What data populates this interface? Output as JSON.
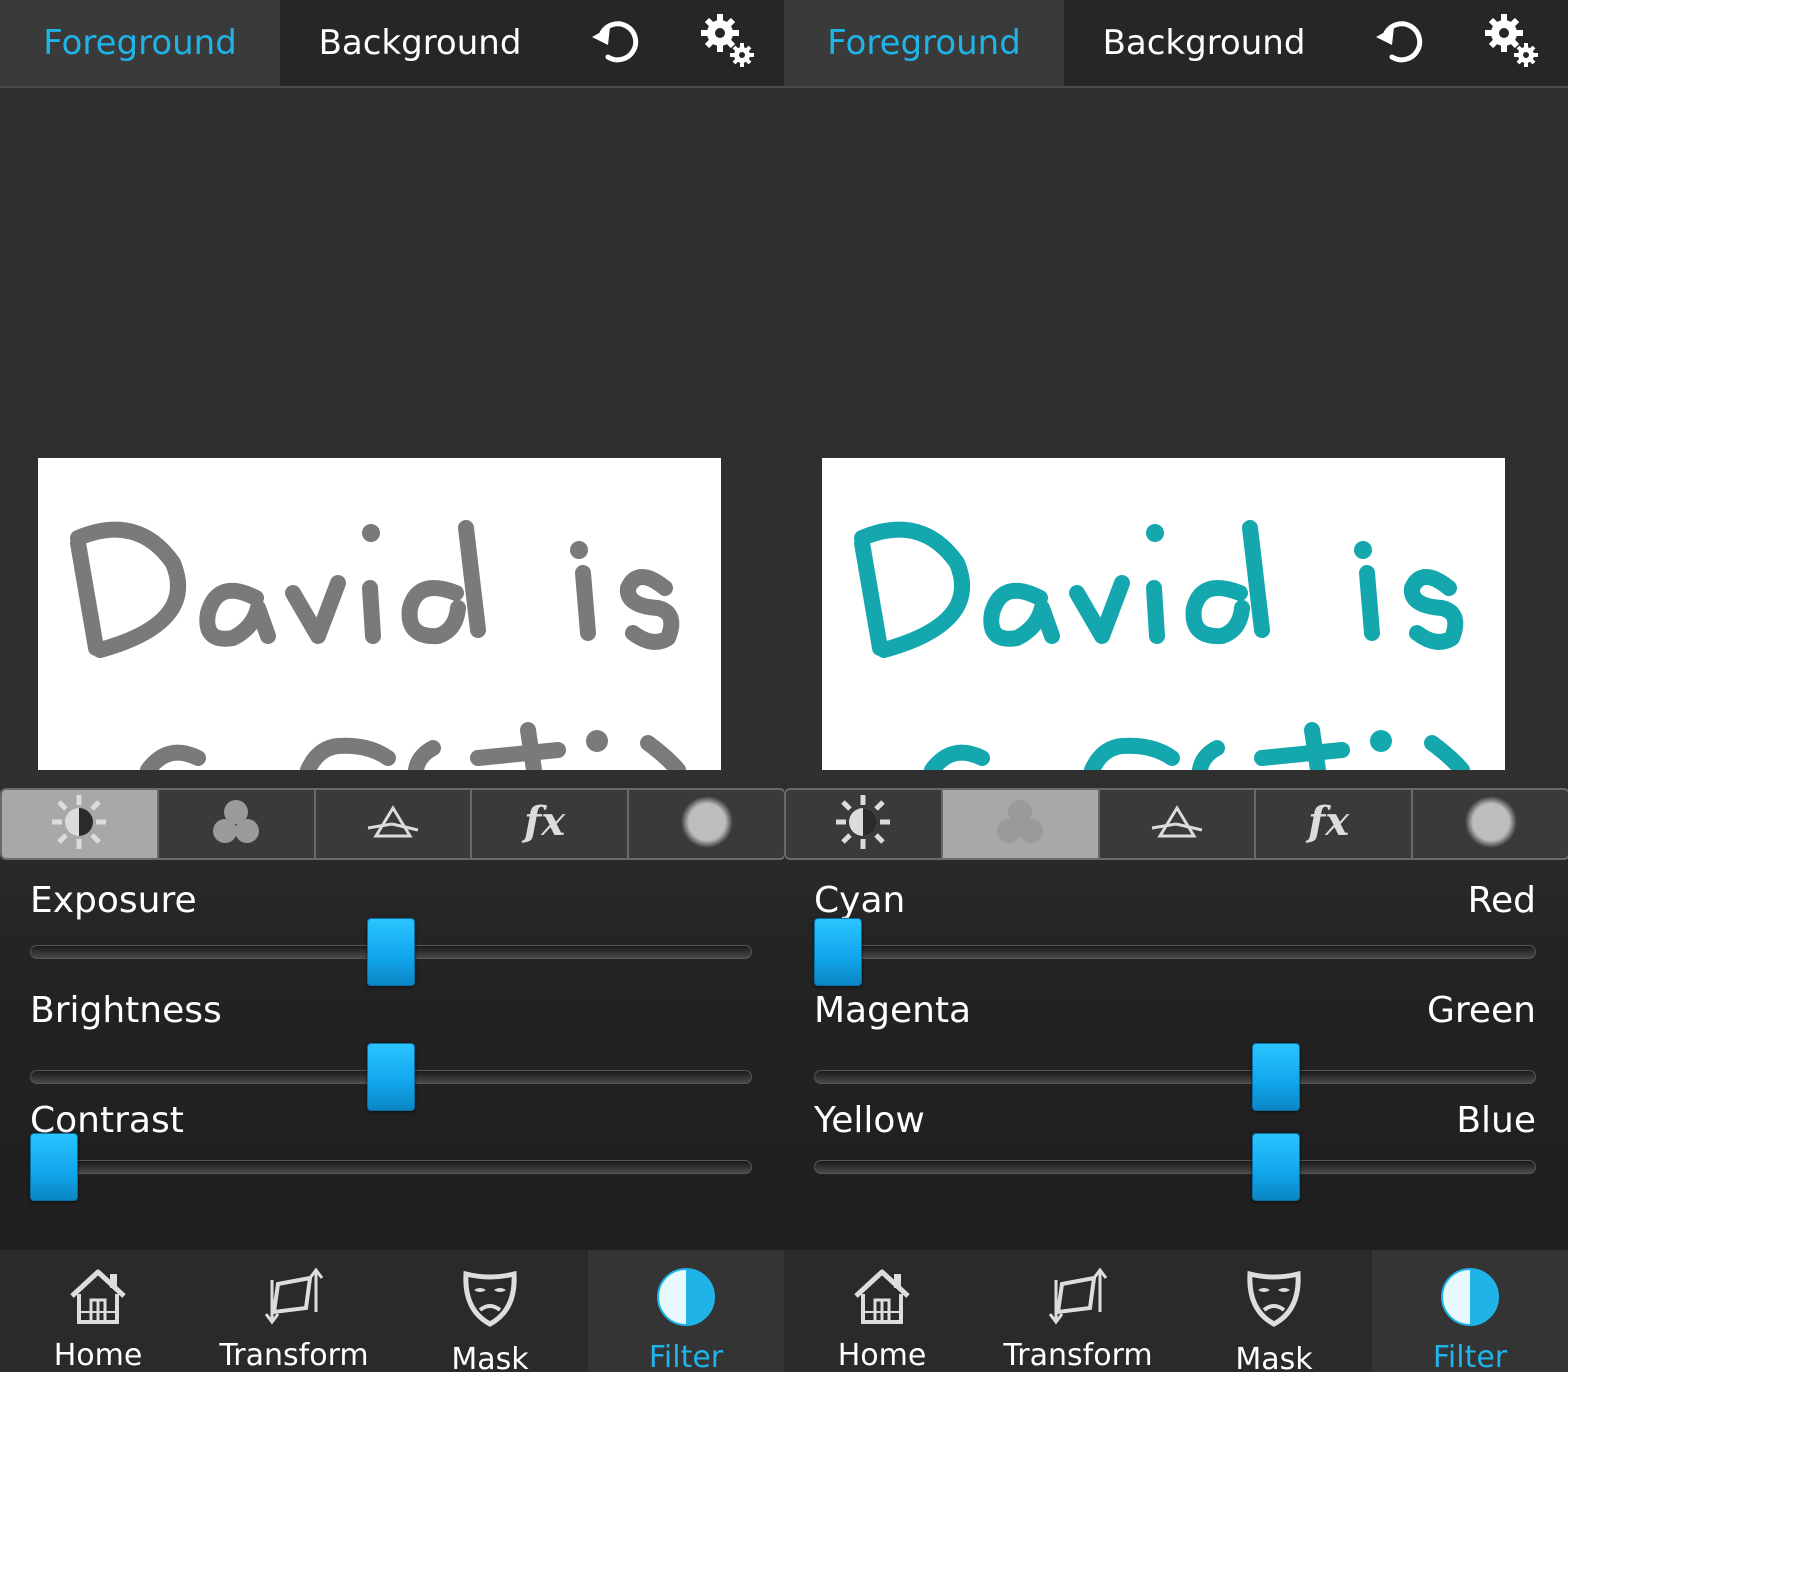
{
  "screens": [
    {
      "top_tabs": {
        "foreground": "Foreground",
        "background": "Background"
      },
      "top_icons": [
        "undo-icon",
        "settings-icon"
      ],
      "photo_text": "David is a rat :)",
      "photo_ink_color": "#7a7a7a",
      "category_tabs": [
        "light-icon",
        "color-icon",
        "prism-icon",
        "fx-icon",
        "blur-icon"
      ],
      "active_category": 0,
      "sliders": [
        {
          "label": "Exposure",
          "right_label": "",
          "value_fraction": 0.5
        },
        {
          "label": "Brightness",
          "right_label": "",
          "value_fraction": 0.5
        },
        {
          "label": "Contrast",
          "right_label": "",
          "value_fraction": 0.0
        }
      ],
      "nav": [
        {
          "label": "Home",
          "icon": "home-icon"
        },
        {
          "label": "Transform",
          "icon": "transform-icon"
        },
        {
          "label": "Mask",
          "icon": "mask-icon"
        },
        {
          "label": "Filter",
          "icon": "filter-icon"
        }
      ],
      "active_nav": 3
    },
    {
      "top_tabs": {
        "foreground": "Foreground",
        "background": "Background"
      },
      "top_icons": [
        "undo-icon",
        "settings-icon"
      ],
      "photo_text": "David is a rat :)",
      "photo_ink_color": "#14a8ae",
      "category_tabs": [
        "light-icon",
        "color-icon",
        "prism-icon",
        "fx-icon",
        "blur-icon"
      ],
      "active_category": 1,
      "sliders": [
        {
          "label": "Cyan",
          "right_label": "Red",
          "value_fraction": 0.0
        },
        {
          "label": "Magenta",
          "right_label": "Green",
          "value_fraction": 0.65
        },
        {
          "label": "Yellow",
          "right_label": "Blue",
          "value_fraction": 0.65
        }
      ],
      "nav": [
        {
          "label": "Home",
          "icon": "home-icon"
        },
        {
          "label": "Transform",
          "icon": "transform-icon"
        },
        {
          "label": "Mask",
          "icon": "mask-icon"
        },
        {
          "label": "Filter",
          "icon": "filter-icon"
        }
      ],
      "active_nav": 3
    }
  ],
  "accent_color": "#1fb3e8"
}
